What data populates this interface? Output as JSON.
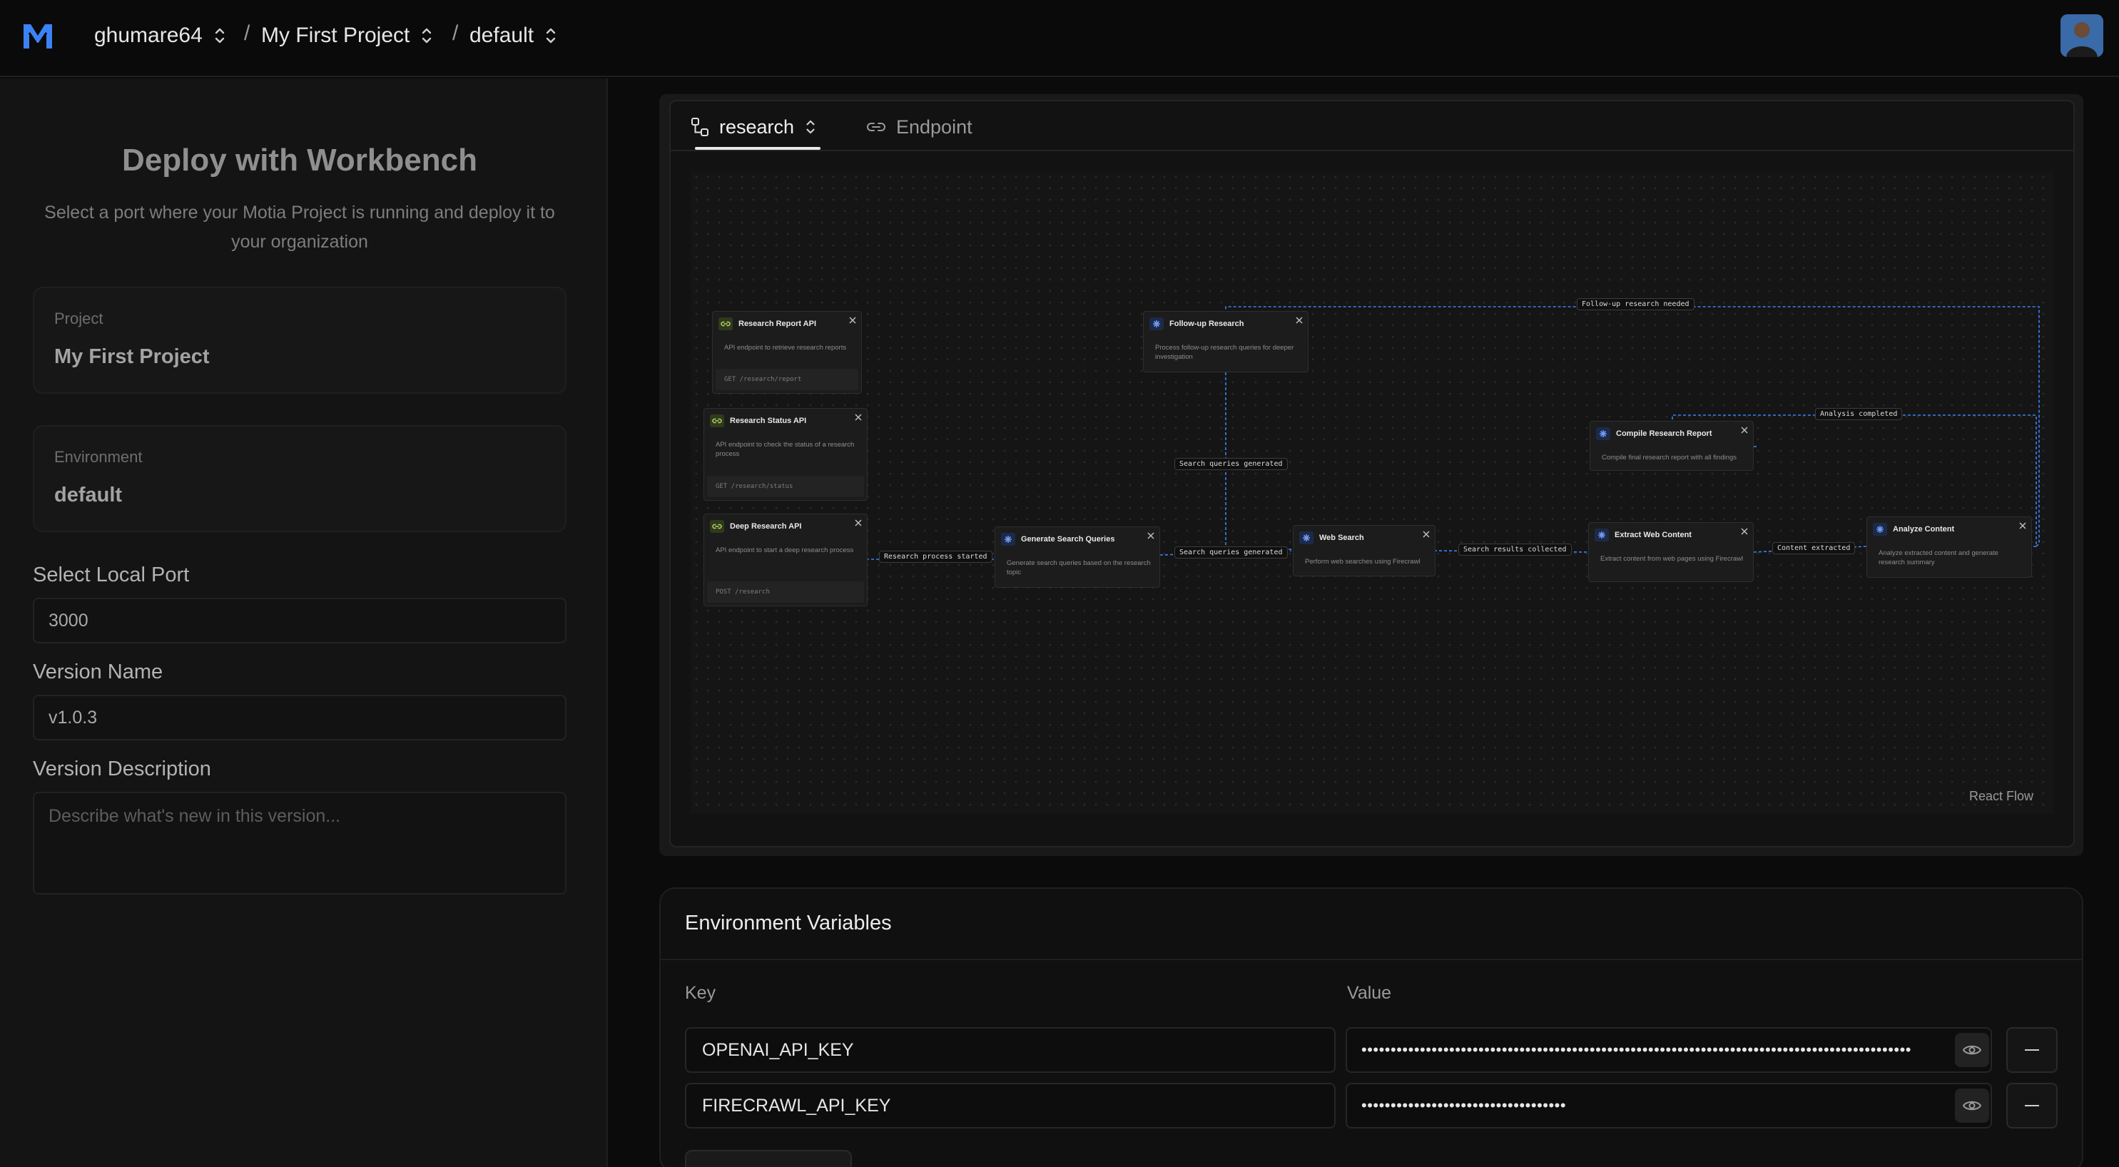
{
  "header": {
    "org": "ghumare64",
    "project": "My First Project",
    "environment": "default"
  },
  "deploy_panel": {
    "title": "Deploy with Workbench",
    "subtitle": "Select a port where your Motia Project is running and deploy it to your organization",
    "project_card": {
      "label": "Project",
      "value": "My First Project"
    },
    "environment_card": {
      "label": "Environment",
      "value": "default"
    },
    "port": {
      "label": "Select Local Port",
      "value": "3000"
    },
    "version_name": {
      "label": "Version Name",
      "value": "v1.0.3"
    },
    "version_description": {
      "label": "Version Description",
      "placeholder": "Describe what's new in this version..."
    }
  },
  "flow": {
    "tabs": [
      {
        "label": "research",
        "icon": "workflow-icon",
        "active": true
      },
      {
        "label": "Endpoint",
        "icon": "link-icon",
        "active": false
      }
    ],
    "attribution": "React Flow",
    "nodes": {
      "report_api": {
        "title": "Research Report API",
        "desc": "API endpoint to retrieve research reports",
        "route": "GET /research/report"
      },
      "status_api": {
        "title": "Research Status API",
        "desc": "API endpoint to check the status of a research process",
        "route": "GET /research/status"
      },
      "deep_api": {
        "title": "Deep Research API",
        "desc": "API endpoint to start a deep research process",
        "route": "POST /research"
      },
      "followup": {
        "title": "Follow-up Research",
        "desc": "Process follow-up research queries for deeper investigation"
      },
      "gen_queries": {
        "title": "Generate Search Queries",
        "desc": "Generate search queries based on the research topic"
      },
      "web_search": {
        "title": "Web Search",
        "desc": "Perform web searches using Firecrawl"
      },
      "compile": {
        "title": "Compile Research Report",
        "desc": "Compile final research report with all findings"
      },
      "extract": {
        "title": "Extract Web Content",
        "desc": "Extract content from web pages using Firecrawl"
      },
      "analyze": {
        "title": "Analyze Content",
        "desc": "Analyze extracted content and generate research summary"
      }
    },
    "edges": {
      "followup_needed": "Follow-up research needed",
      "analysis_completed": "Analysis completed",
      "queries_generated_1": "Search queries generated",
      "queries_generated_2": "Search queries generated",
      "process_started": "Research process started",
      "results_collected": "Search results collected",
      "content_extracted": "Content extracted"
    }
  },
  "env_vars": {
    "title": "Environment Variables",
    "key_header": "Key",
    "value_header": "Value",
    "rows": [
      {
        "key": "OPENAI_API_KEY",
        "value": "••••••••••••••••••••••••••••••••••••••••••••••••••••••••••••••••••••••••••••••••••••••••••••••"
      },
      {
        "key": "FIRECRAWL_API_KEY",
        "value": "•••••••••••••••••••••••••••••••••••"
      }
    ]
  },
  "colors": {
    "accent": "#3b82f6",
    "api_icon_bg": "#2f3a1b",
    "event_icon_bg": "#1c2a4a",
    "edge": "#3b82f6"
  }
}
